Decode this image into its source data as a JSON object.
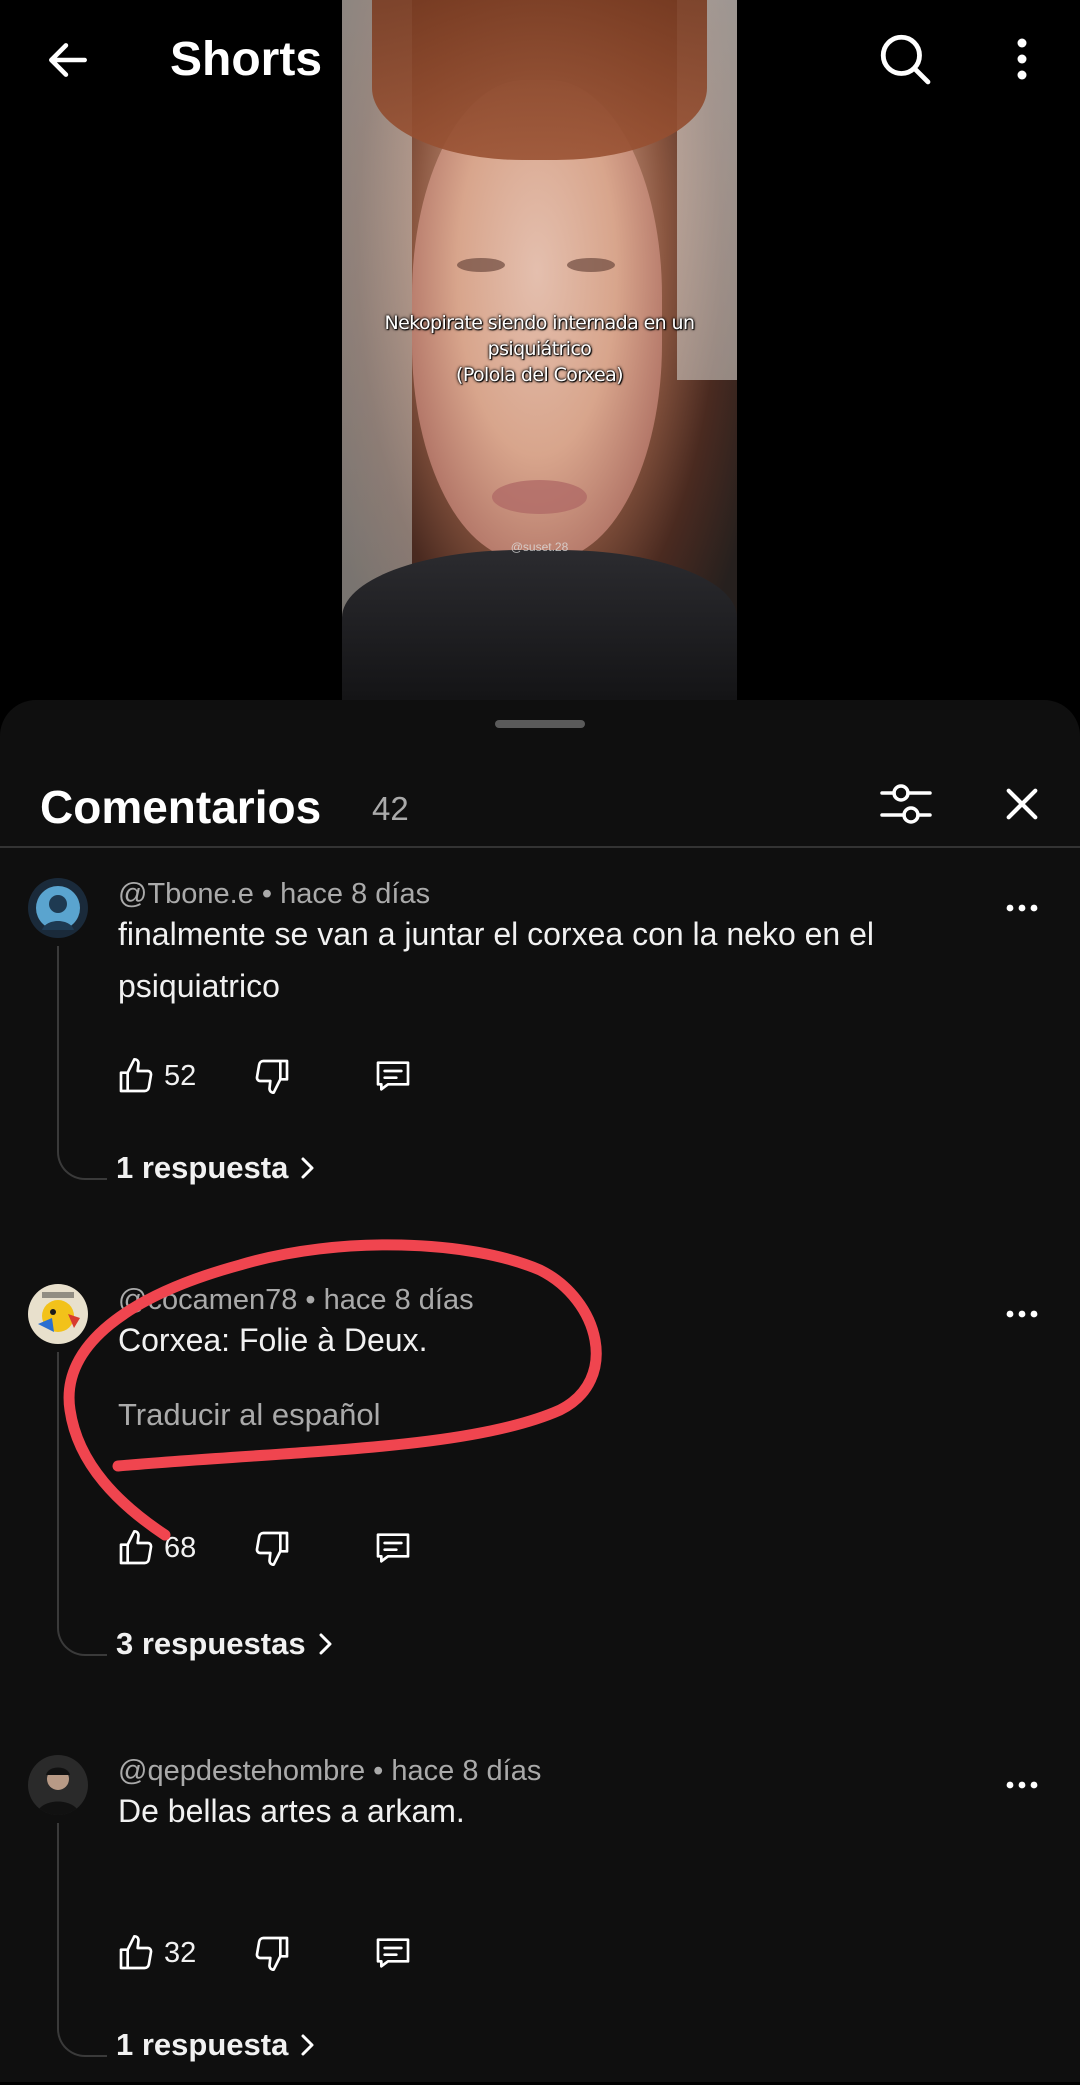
{
  "topbar": {
    "title": "Shorts",
    "back_icon": "arrow-left-icon",
    "search_icon": "search-icon",
    "more_icon": "more-vert-icon"
  },
  "video": {
    "caption_lines": [
      "Nekopirate siendo internada en un",
      "psiquiátrico",
      "(Polola del Corxea)"
    ],
    "watermark": "@suset.28"
  },
  "comments_panel": {
    "title": "Comentarios",
    "count": "42",
    "filter_icon": "sliders-icon",
    "close_icon": "close-icon"
  },
  "comments": [
    {
      "author": "@Tbone.e",
      "time": "hace 8 días",
      "text": "finalmente se van a juntar el corxea con la neko en el psiquiatrico",
      "likes": "52",
      "replies": "1 respuesta"
    },
    {
      "author": "@cocamen78",
      "time": "hace 8 días",
      "text": "Corxea: Folie à Deux.",
      "translate": "Traducir al español",
      "likes": "68",
      "replies": "3 respuestas"
    },
    {
      "author": "@qepdestehombre",
      "time": "hace 8 días",
      "text": "De bellas artes a arkam.",
      "likes": "32",
      "replies": "1 respuesta"
    }
  ],
  "colors": {
    "panel_bg": "#0f0f0f",
    "annotation_circle": "#f0454f"
  }
}
